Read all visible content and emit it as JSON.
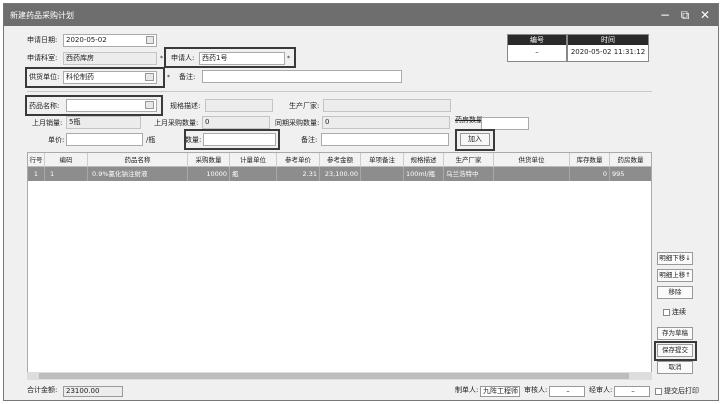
{
  "window": {
    "title": "新建药品采购计划",
    "minimize": "−",
    "restore": "⧉",
    "close": "✕"
  },
  "form": {
    "apply_date_label": "申请日期:",
    "apply_date_value": "2020-05-02",
    "apply_dept_label": "申请科室:",
    "apply_dept_value": "西药库房",
    "applicant_label": "申请人:",
    "applicant_value": "西药1号",
    "supplier_label": "供货单位:",
    "supplier_value": "科伦制药",
    "remark_label": "备注:",
    "required_mark": "*",
    "info": {
      "code_header": "编号",
      "code_value": "–",
      "time_header": "时间",
      "time_value": "2020-05-02 11:31:12"
    }
  },
  "drug": {
    "name_label": "药品名称:",
    "spec_label": "规格描述:",
    "maker_label": "生产厂家:",
    "last_month_sales_label": "上月销量:",
    "last_month_sales_value": "5瓶",
    "last_month_purchase_label": "上月采购数量:",
    "last_month_purchase_value": "0",
    "same_period_label": "同期采购数量:",
    "same_period_value": "0",
    "stock_label": "药房数量",
    "price_label": "单价:",
    "price_unit": "/瓶",
    "qty_label": "数量:",
    "remark2_label": "备注:",
    "add_button": "加入"
  },
  "table": {
    "columns": [
      "行号",
      "编码",
      "药品名称",
      "采购数量",
      "计量单位",
      "参考单价",
      "参考金额",
      "单项备注",
      "规格描述",
      "生产厂家",
      "供货单位",
      "库存数量",
      "药房数量"
    ],
    "rows": [
      [
        "1",
        "1",
        "0.9%氯化钠注射液",
        "10000",
        "瓶",
        "2.31",
        "23,100.00",
        "",
        "100ml/瓶",
        "乌兰浩特中",
        "",
        "0",
        "995"
      ]
    ]
  },
  "side_buttons": {
    "move_down": "明细下移↓",
    "move_up": "明细上移↑",
    "remove": "移除",
    "continuous": "连续",
    "save_draft": "存为草稿",
    "save_submit": "保存提交",
    "cancel": "取消"
  },
  "footer": {
    "total_label": "合计金额:",
    "total_value": "23100.00",
    "maker_label": "制单人:",
    "maker_value": "九阵工程师",
    "reviewer_label": "审核人:",
    "reviewer_value": "–",
    "approver_label": "经审人:",
    "approver_value": "–",
    "print_after_label": "提交后打印"
  }
}
